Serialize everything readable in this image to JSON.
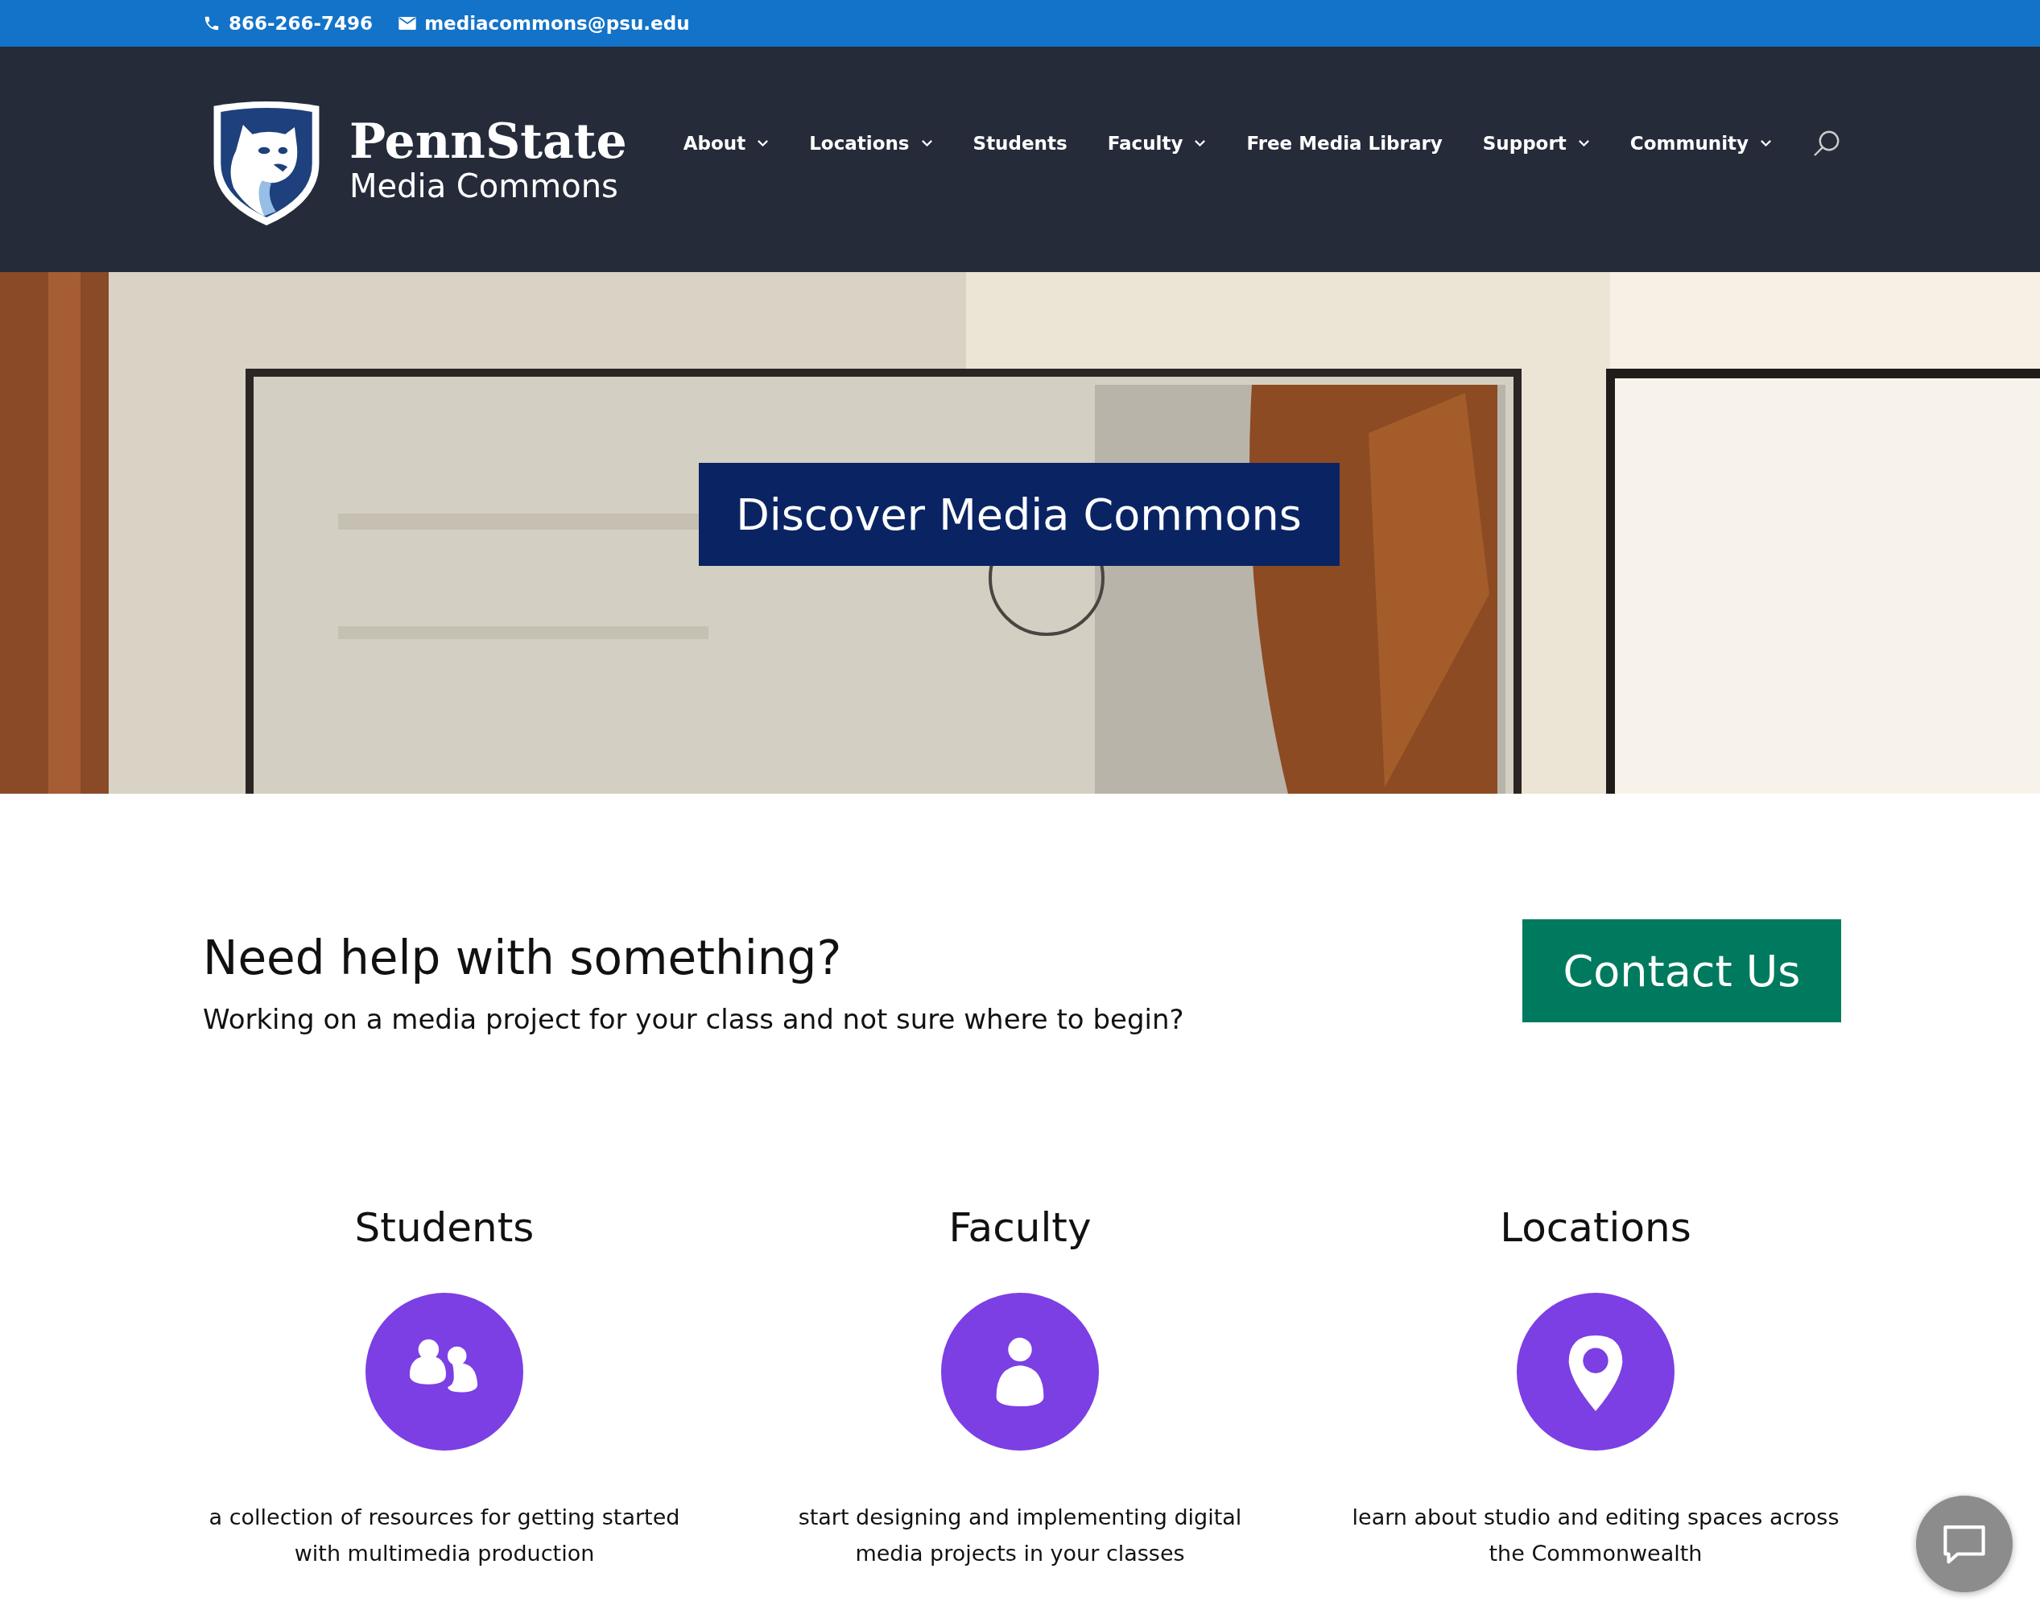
{
  "top_bar": {
    "phone": "866-266-7496",
    "email": "mediacommons@psu.edu"
  },
  "header": {
    "logo": {
      "wordmark": "PennState",
      "subtitle": "Media Commons"
    },
    "nav": [
      {
        "label": "About",
        "dropdown": true
      },
      {
        "label": "Locations",
        "dropdown": true
      },
      {
        "label": "Students",
        "dropdown": false
      },
      {
        "label": "Faculty",
        "dropdown": true
      },
      {
        "label": "Free Media Library",
        "dropdown": false
      },
      {
        "label": "Support",
        "dropdown": true
      },
      {
        "label": "Community",
        "dropdown": true
      }
    ]
  },
  "hero": {
    "kind": "picture",
    "button": "Discover Media Commons"
  },
  "help": {
    "title": "Need help with something?",
    "text": "Working on a media project for your class and not sure where to begin?",
    "button": "Contact Us"
  },
  "features": [
    {
      "title": "Students",
      "kind": "people",
      "description": "a collection of resources for getting started with multimedia production"
    },
    {
      "title": "Faculty",
      "kind": "person",
      "description": "start designing and implementing digital media projects in your classes"
    },
    {
      "title": "Locations",
      "kind": "pin",
      "description": "learn about studio and editing spaces across the Commonwealth"
    }
  ]
}
